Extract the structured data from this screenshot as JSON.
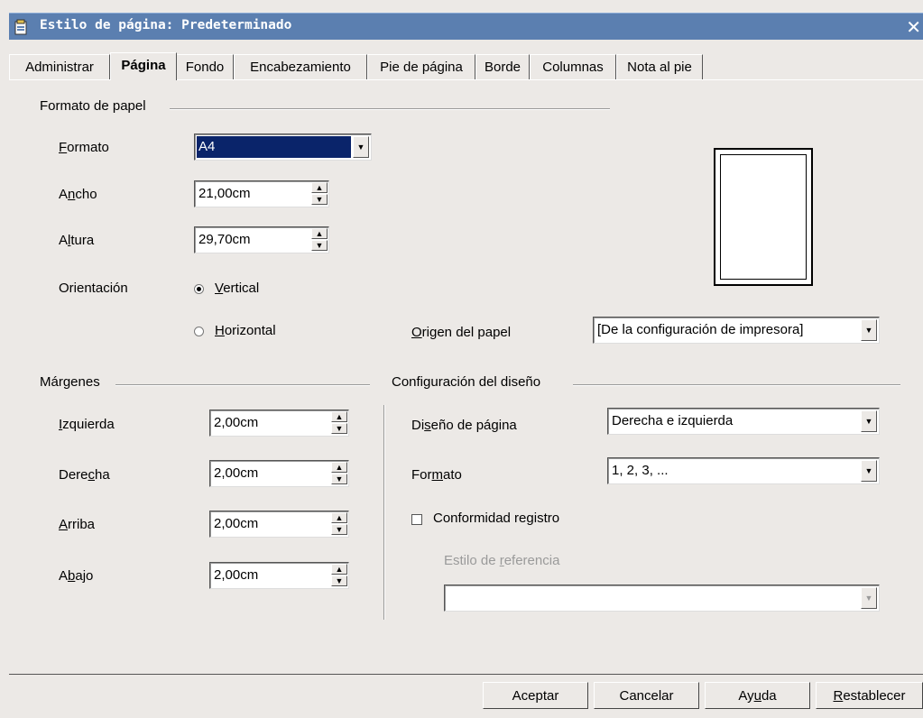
{
  "window": {
    "title": "Estilo de página: Predeterminado",
    "close_glyph": "✕"
  },
  "tabs": [
    {
      "label": "Administrar"
    },
    {
      "label": "Página"
    },
    {
      "label": "Fondo"
    },
    {
      "label": "Encabezamiento"
    },
    {
      "label": "Pie de página"
    },
    {
      "label": "Borde"
    },
    {
      "label": "Columnas"
    },
    {
      "label": "Nota al pie"
    }
  ],
  "paper": {
    "group_label": "Formato de papel",
    "format_label": "Formato",
    "format_value": "A4",
    "width_label": "Ancho",
    "width_value": "21,00cm",
    "height_label": "Altura",
    "height_value": "29,70cm",
    "orientation_label": "Orientación",
    "orientation_portrait": "Vertical",
    "orientation_landscape": "Horizontal",
    "source_label": "Origen del papel",
    "source_value": "[De la configuración de impresora]"
  },
  "margins": {
    "group_label": "Márgenes",
    "left_label": "Izquierda",
    "left_value": "2,00cm",
    "right_label": "Derecha",
    "right_value": "2,00cm",
    "top_label": "Arriba",
    "top_value": "2,00cm",
    "bottom_label": "Abajo",
    "bottom_value": "2,00cm"
  },
  "layout": {
    "group_label": "Configuración del diseño",
    "page_layout_label": "Diseño de página",
    "page_layout_value": "Derecha e izquierda",
    "format_label": "Formato",
    "format_value": "1, 2, 3, ...",
    "register_label": "Conformidad registro",
    "reference_label": "Estilo de referencia",
    "reference_value": ""
  },
  "buttons": {
    "ok": "Aceptar",
    "cancel": "Cancelar",
    "help": "Ayuda",
    "reset": "Restablecer"
  },
  "colors": {
    "titlebar": "#5b7fb0",
    "selection": "#0a246a",
    "dialog": "#ece9e6"
  }
}
